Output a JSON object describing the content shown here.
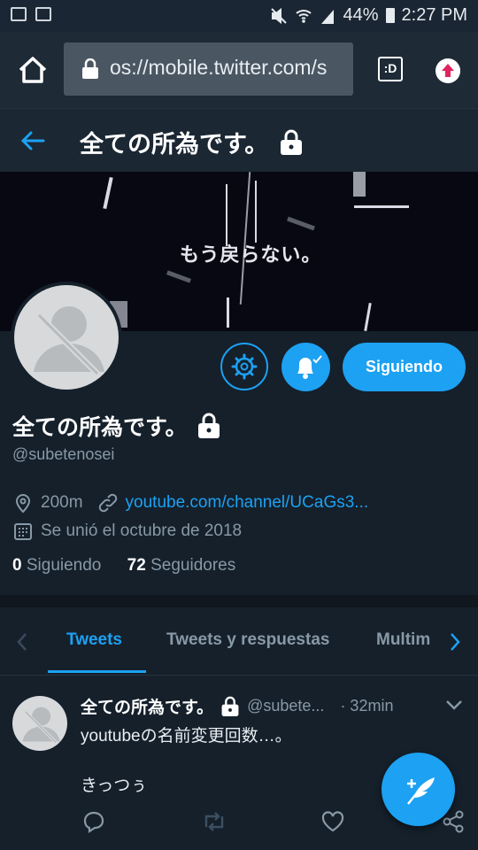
{
  "status_bar": {
    "battery": "44%",
    "time": "2:27 PM"
  },
  "browser": {
    "url": "os://mobile.twitter.com/s",
    "tab_label": ":D"
  },
  "header": {
    "title": "全ての所為です。"
  },
  "banner": {
    "caption": "もう戻らない。"
  },
  "profile": {
    "name": "全ての所為です。",
    "handle": "@subetenosei",
    "location": "200m",
    "website": "youtube.com/channel/UCaGs3...",
    "joined": "Se unió el octubre de 2018",
    "following_count": "0",
    "following_label": "Siguiendo",
    "followers_count": "72",
    "followers_label": "Seguidores",
    "follow_button": "Siguiendo"
  },
  "tabs": [
    {
      "label": "Tweets",
      "active": true
    },
    {
      "label": "Tweets y respuestas",
      "active": false
    },
    {
      "label": "Multim",
      "active": false
    }
  ],
  "tweet": {
    "name": "全ての所為です。",
    "handle": "@subete...",
    "time": "· 32min",
    "text": "youtubeの名前変更回数…。\n\nきっつぅ"
  },
  "colors": {
    "accent": "#1da1f2",
    "background": "#15202b",
    "secondary_text": "#8899a6"
  },
  "icons": [
    "home-icon",
    "lock-icon",
    "tab-icon",
    "upload-icon",
    "back-arrow-icon",
    "gear-icon",
    "bell-icon",
    "location-icon",
    "link-icon",
    "calendar-icon",
    "chevron-left-icon",
    "chevron-right-icon",
    "chevron-down-icon",
    "reply-icon",
    "retweet-icon",
    "like-icon",
    "share-icon",
    "compose-icon"
  ]
}
